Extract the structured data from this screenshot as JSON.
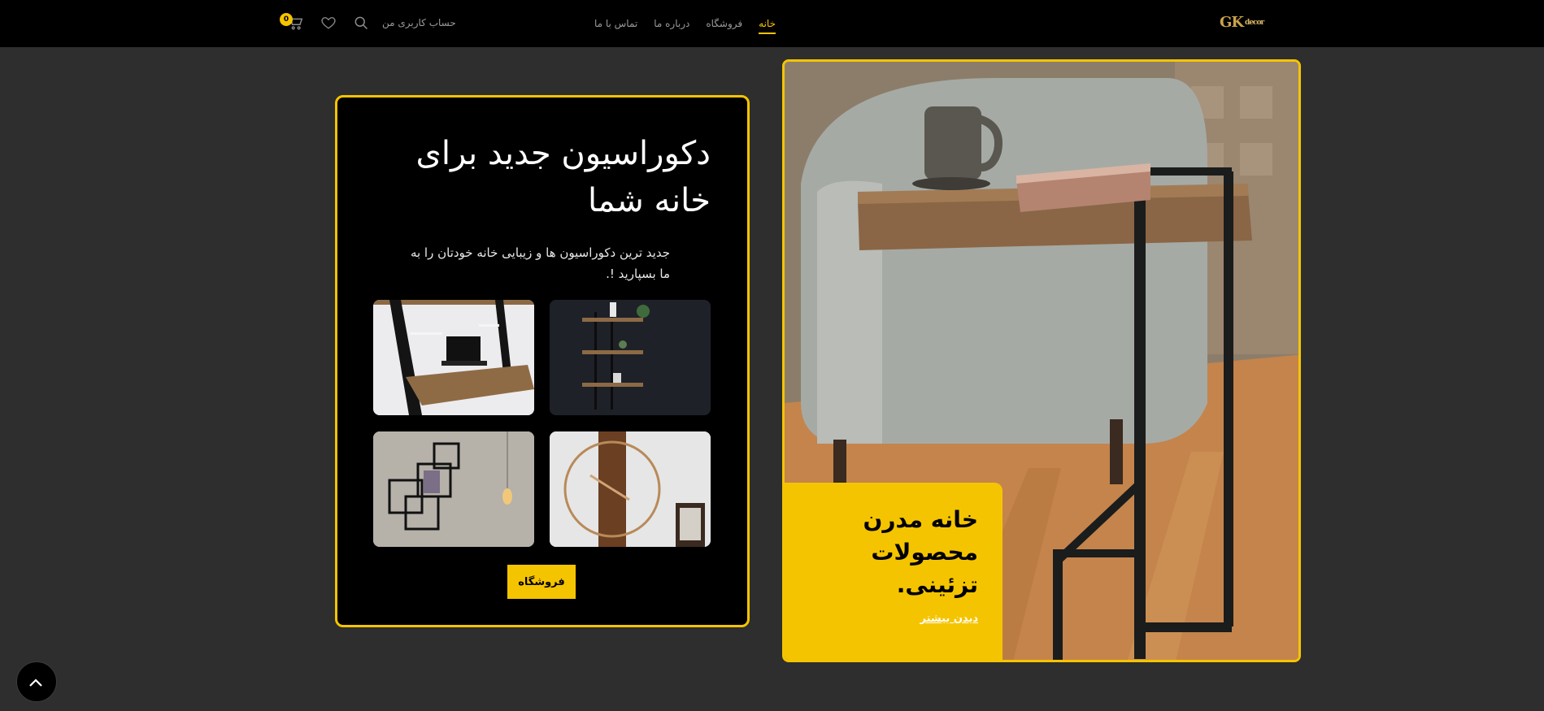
{
  "header": {
    "logo_text": "GK",
    "logo_small": "decor",
    "nav": [
      {
        "label": "خانه",
        "active": true
      },
      {
        "label": "فروشگاه",
        "active": false
      },
      {
        "label": "درباره ما",
        "active": false
      },
      {
        "label": "تماس با ما",
        "active": false
      }
    ],
    "account_label": "حساب کاربری من",
    "cart_count": "0",
    "icons": [
      "cart-icon",
      "heart-icon",
      "search-icon"
    ]
  },
  "promo": {
    "title": "دکوراسیون جدید برای خانه شما",
    "subtitle": "جدید ترین دکوراسیون ها و زیبایی خانه خودتان را به ما بسپارید !.",
    "button_label": "فروشگاه"
  },
  "hero": {
    "title": "خانه مدرن محصولات تزئینی.",
    "link_label": "دیدن بیشتر"
  },
  "colors": {
    "accent": "#f5c400",
    "background": "#2e2e2e",
    "header": "#000000"
  }
}
